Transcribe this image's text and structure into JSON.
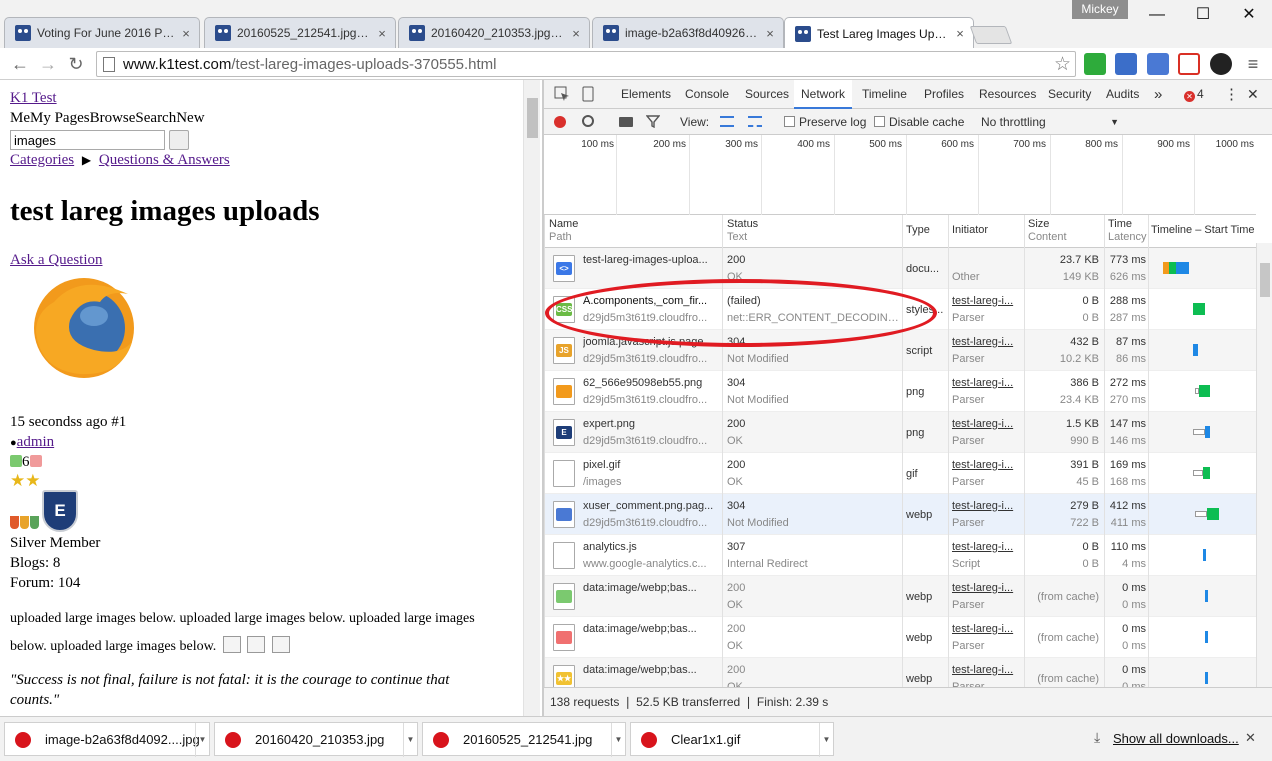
{
  "browser": {
    "tabs": [
      {
        "title": "Voting For June 2016 POTM",
        "active": false
      },
      {
        "title": "20160525_212541.jpg (900",
        "active": false
      },
      {
        "title": "20160420_210353.jpg (900",
        "active": false
      },
      {
        "title": "image-b2a63f8d409266f05",
        "active": false
      },
      {
        "title": "Test Lareg Images Upload",
        "active": true
      }
    ],
    "tab_close": "×",
    "profile_name": "Mickey",
    "window_controls": {
      "minimize": "—",
      "maximize": "☐",
      "close": "✕"
    },
    "url_host": "www.k1test.com",
    "url_path": "/test-lareg-images-uploads-370555.html",
    "star_glyph": "☆",
    "nav_glyphs": {
      "back": "←",
      "forward": "→",
      "reload": "↻",
      "menu": "≡"
    }
  },
  "page": {
    "site_link": "K1 Test",
    "nav_text": "MeMy PagesBrowseSearchNew",
    "search_value": "images",
    "breadcrumb_categories": "Categories",
    "breadcrumb_arrow": "▶",
    "breadcrumb_qa": "Questions & Answers",
    "title": "test lareg images uploads",
    "ask_link": "Ask a Question",
    "post_time": "15 secondss ago #1",
    "bullet": "●",
    "author": "admin",
    "vote_count": "6",
    "stars": "★★",
    "badge_letter": "E",
    "member_level": "Silver Member",
    "blogs": "Blogs: 8",
    "forum": "Forum: 104",
    "body_line1": "uploaded large images below. uploaded large images below. uploaded large images",
    "body_line2": "below. uploaded large images below.",
    "quote_line1": "\"Success is not final, failure is not fatal: it is the courage to continue that",
    "quote_line2": "counts.\""
  },
  "devtools": {
    "panel_tabs": [
      "Elements",
      "Console",
      "Sources",
      "Network",
      "Timeline",
      "Profiles",
      "Resources",
      "Security",
      "Audits"
    ],
    "active_tab": "Network",
    "more_tabs": "»",
    "error_count": "4",
    "menu_glyph": "⋮",
    "close_glyph": "✕",
    "view_label": "View:",
    "preserve_log": "Preserve log",
    "disable_cache": "Disable cache",
    "throttling": "No throttling",
    "dropdown_glyph": "▼",
    "overview_ticks": [
      "100 ms",
      "200 ms",
      "300 ms",
      "400 ms",
      "500 ms",
      "600 ms",
      "700 ms",
      "800 ms",
      "900 ms",
      "1000 ms"
    ],
    "columns": {
      "name": "Name",
      "path": "Path",
      "status": "Status",
      "text": "Text",
      "type": "Type",
      "initiator": "Initiator",
      "size": "Size",
      "content": "Content",
      "time": "Time",
      "latency": "Latency",
      "timeline": "Timeline – Start Time"
    },
    "requests": [
      {
        "name": "test-lareg-images-uploa...",
        "path": "",
        "status": "200",
        "text": "OK",
        "type": "docu...",
        "initiator": "",
        "initiator_sub": "Other",
        "size": "23.7 KB",
        "content": "149 KB",
        "time": "773 ms",
        "latency": "626 ms",
        "icon": "doc"
      },
      {
        "name": "A.components,_com_fir...",
        "path": "d29jd5m3t61t9.cloudfro...",
        "status": "(failed)",
        "text": "net::ERR_CONTENT_DECODING_...",
        "type": "styles...",
        "initiator": "test-lareg-i...",
        "initiator_sub": "Parser",
        "size": "0 B",
        "content": "0 B",
        "time": "288 ms",
        "latency": "287 ms",
        "icon": "css"
      },
      {
        "name": "joomla.javascript.js.page...",
        "path": "d29jd5m3t61t9.cloudfro...",
        "status": "304",
        "text": "Not Modified",
        "type": "script",
        "initiator": "test-lareg-i...",
        "initiator_sub": "Parser",
        "size": "432 B",
        "content": "10.2 KB",
        "time": "87 ms",
        "latency": "86 ms",
        "icon": "js"
      },
      {
        "name": "62_566e95098eb55.png",
        "path": "d29jd5m3t61t9.cloudfro...",
        "status": "304",
        "text": "Not Modified",
        "type": "png",
        "initiator": "test-lareg-i...",
        "initiator_sub": "Parser",
        "size": "386 B",
        "content": "23.4 KB",
        "time": "272 ms",
        "latency": "270 ms",
        "icon": "firefox"
      },
      {
        "name": "expert.png",
        "path": "d29jd5m3t61t9.cloudfro...",
        "status": "200",
        "text": "OK",
        "type": "png",
        "initiator": "test-lareg-i...",
        "initiator_sub": "Parser",
        "size": "1.5 KB",
        "content": "990 B",
        "time": "147 ms",
        "latency": "146 ms",
        "icon": "shield"
      },
      {
        "name": "pixel.gif",
        "path": "/images",
        "status": "200",
        "text": "OK",
        "type": "gif",
        "initiator": "test-lareg-i...",
        "initiator_sub": "Parser",
        "size": "391 B",
        "content": "45 B",
        "time": "169 ms",
        "latency": "168 ms",
        "icon": "blank"
      },
      {
        "name": "xuser_comment.png.pag...",
        "path": "d29jd5m3t61t9.cloudfro...",
        "status": "304",
        "text": "Not Modified",
        "type": "webp",
        "initiator": "test-lareg-i...",
        "initiator_sub": "Parser",
        "size": "279 B",
        "content": "722 B",
        "time": "412 ms",
        "latency": "411 ms",
        "icon": "comment"
      },
      {
        "name": "analytics.js",
        "path": "www.google-analytics.c...",
        "status": "307",
        "text": "Internal Redirect",
        "type": "",
        "initiator": "test-lareg-i...",
        "initiator_sub": "Script",
        "size": "0 B",
        "content": "0 B",
        "time": "110 ms",
        "latency": "4 ms",
        "icon": "blank"
      },
      {
        "name": "data:image/webp;bas...",
        "path": "",
        "status": "200",
        "text": "OK",
        "type": "webp",
        "initiator": "test-lareg-i...",
        "initiator_sub": "Parser",
        "size": "(from cache)",
        "content": "",
        "time": "0 ms",
        "latency": "0 ms",
        "icon": "green"
      },
      {
        "name": "data:image/webp;bas...",
        "path": "",
        "status": "200",
        "text": "OK",
        "type": "webp",
        "initiator": "test-lareg-i...",
        "initiator_sub": "Parser",
        "size": "(from cache)",
        "content": "",
        "time": "0 ms",
        "latency": "0 ms",
        "icon": "red"
      },
      {
        "name": "data:image/webp;bas...",
        "path": "",
        "status": "200",
        "text": "OK",
        "type": "webp",
        "initiator": "test-lareg-i...",
        "initiator_sub": "Parser",
        "size": "(from cache)",
        "content": "",
        "time": "0 ms",
        "latency": "0 ms",
        "icon": "star"
      }
    ],
    "status_bar": "138 requests  ❘  52.5 KB transferred  ❘  Finish: 2.39 s",
    "colors": {
      "accent": "#3879d9",
      "record": "#d9302c",
      "highlight": "#e01b22",
      "bar_green": "#0dbd52",
      "bar_blue": "#1e88e5"
    }
  },
  "downloads": {
    "items": [
      "image-b2a63f8d4092....jpg",
      "20160420_210353.jpg",
      "20160525_212541.jpg",
      "Clear1x1.gif"
    ],
    "arrow": "▼",
    "show_all": "Show all downloads...",
    "close": "✕"
  }
}
